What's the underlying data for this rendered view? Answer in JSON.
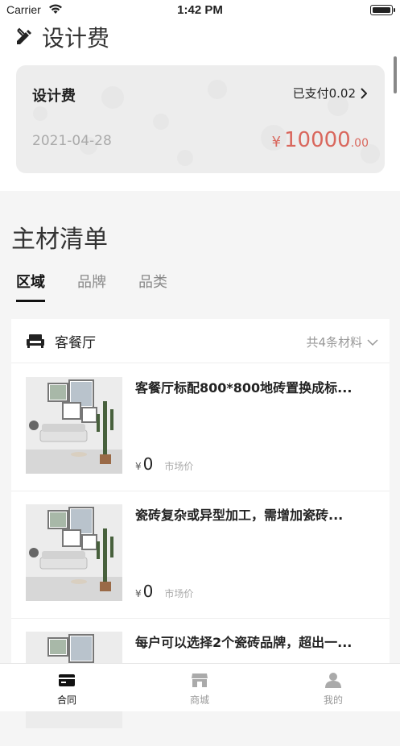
{
  "status_bar": {
    "carrier": "Carrier",
    "time": "1:42 PM"
  },
  "design_fee": {
    "section_title": "设计费",
    "card": {
      "name": "设计费",
      "paid_label": "已支付0.02",
      "date": "2021-04-28",
      "currency": "¥",
      "amount_int": "10000",
      "amount_dec": ".00"
    }
  },
  "materials": {
    "title": "主材清单",
    "tabs": [
      "区域",
      "品牌",
      "品类"
    ],
    "active_tab": 0,
    "group": {
      "name": "客餐厅",
      "count_label": "共4条材料"
    },
    "items": [
      {
        "title": "客餐厅标配800*800地砖置换成标...",
        "currency": "¥",
        "price": "0",
        "note": "市场价"
      },
      {
        "title": "瓷砖复杂或异型加工，需增加瓷砖...",
        "currency": "¥",
        "price": "0",
        "note": "市场价"
      },
      {
        "title": "每户可以选择2个瓷砖品牌，超出一...",
        "currency": "¥",
        "price": "0",
        "note": "市场价"
      }
    ]
  },
  "tab_bar": [
    {
      "label": "合同",
      "icon": "contract-icon",
      "active": true
    },
    {
      "label": "商城",
      "icon": "store-icon",
      "active": false
    },
    {
      "label": "我的",
      "icon": "profile-icon",
      "active": false
    }
  ],
  "colors": {
    "accent_price": "#d9675d",
    "active_text": "#111111",
    "inactive_text": "#888888"
  }
}
